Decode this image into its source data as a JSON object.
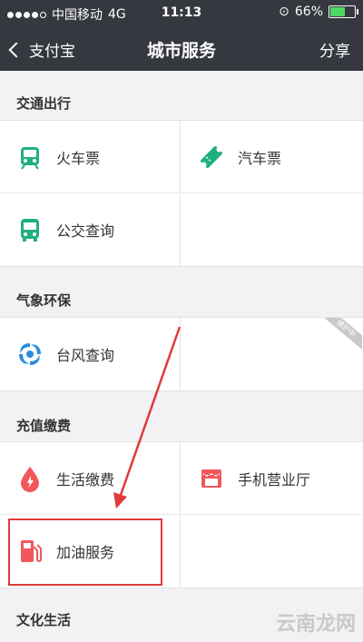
{
  "status_bar": {
    "carrier": "中国移动",
    "network": "4G",
    "time": "11:13",
    "battery_percent": "66%",
    "battery_level": 0.66
  },
  "nav": {
    "back_label": "支付宝",
    "title": "城市服务",
    "share_label": "分享"
  },
  "sections": [
    {
      "title": "交通出行",
      "items": [
        {
          "label": "火车票",
          "icon": "train-icon"
        },
        {
          "label": "汽车票",
          "icon": "ticket-icon"
        },
        {
          "label": "公交查询",
          "icon": "bus-icon"
        }
      ]
    },
    {
      "title": "气象环保",
      "items": [
        {
          "label": "台风查询",
          "icon": "typhoon-icon",
          "badge": "维护中"
        }
      ]
    },
    {
      "title": "充值缴费",
      "items": [
        {
          "label": "生活缴费",
          "icon": "utility-drop-icon"
        },
        {
          "label": "手机营业厅",
          "icon": "phone-hall-icon"
        },
        {
          "label": "加油服务",
          "icon": "gas-pump-icon"
        }
      ]
    },
    {
      "title": "文化生活",
      "items": []
    }
  ],
  "watermark": "云南龙网",
  "colors": {
    "header_bg": "#35383f",
    "green": "#21b07d",
    "blue": "#2a8cdc",
    "red": "#f0585b",
    "highlight": "#e03a3a"
  }
}
